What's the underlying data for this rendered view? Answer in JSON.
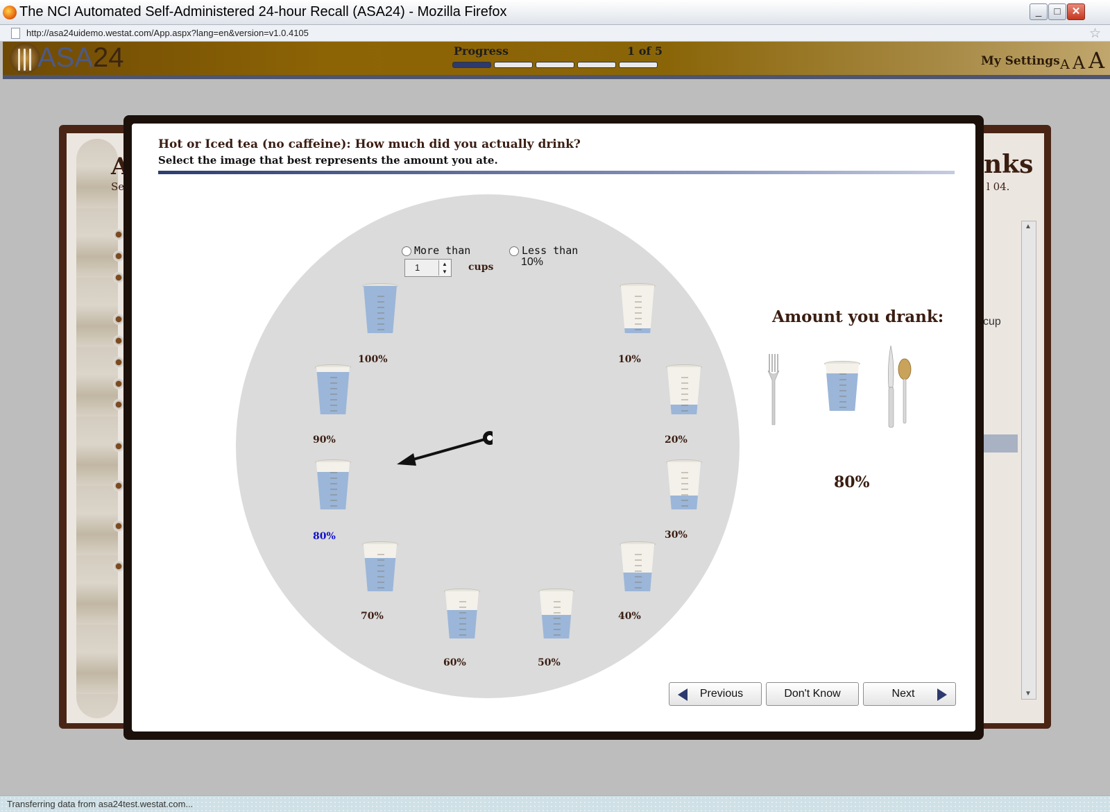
{
  "window": {
    "title": "The NCI Automated Self-Administered 24-hour Recall (ASA24) - Mozilla Firefox",
    "minimize": "_",
    "maximize": "□",
    "close": "✕"
  },
  "browser": {
    "url": "http://asa24uidemo.westat.com/App.aspx?lang=en&version=v1.0.4105",
    "status": "Transferring data from asa24test.westat.com..."
  },
  "header": {
    "logo_asa": "ASA",
    "logo_num": "24",
    "progress_label": "Progress",
    "progress_count": "1 of 5",
    "progress_total": 5,
    "progress_done": 1,
    "my_settings": "My Settings",
    "font_sizes": [
      "A",
      "A",
      "A"
    ]
  },
  "background": {
    "title_left": "A",
    "sub_left": "Se",
    "title_right": "nks",
    "sub_right": "l 04.",
    "cup_text": "cup"
  },
  "modal": {
    "question": "Hot or Iced tea (no caffeine): How much did you actually drink?",
    "instruction": "Select the image that best represents the amount you ate.",
    "more_than": "More than",
    "less_than": "Less than",
    "less_than_value": "10%",
    "quantity": "1",
    "unit": "cups",
    "cups": [
      {
        "label": "10%",
        "fill": 0.1
      },
      {
        "label": "20%",
        "fill": 0.2
      },
      {
        "label": "30%",
        "fill": 0.3
      },
      {
        "label": "40%",
        "fill": 0.4
      },
      {
        "label": "50%",
        "fill": 0.5
      },
      {
        "label": "60%",
        "fill": 0.6
      },
      {
        "label": "70%",
        "fill": 0.7
      },
      {
        "label": "80%",
        "fill": 0.8
      },
      {
        "label": "90%",
        "fill": 0.9
      },
      {
        "label": "100%",
        "fill": 1.0
      }
    ],
    "selected": "80%",
    "selected_fill": 0.8,
    "amount_title": "Amount you drank:",
    "amount_value": "80%"
  },
  "buttons": {
    "previous": "Previous",
    "dont_know": "Don't Know",
    "next": "Next"
  },
  "colors": {
    "header_brown": "#8d6405",
    "accent_navy": "#2d3a6e",
    "selected_label": "#1010c8",
    "liquid": "#9bb6d8"
  }
}
